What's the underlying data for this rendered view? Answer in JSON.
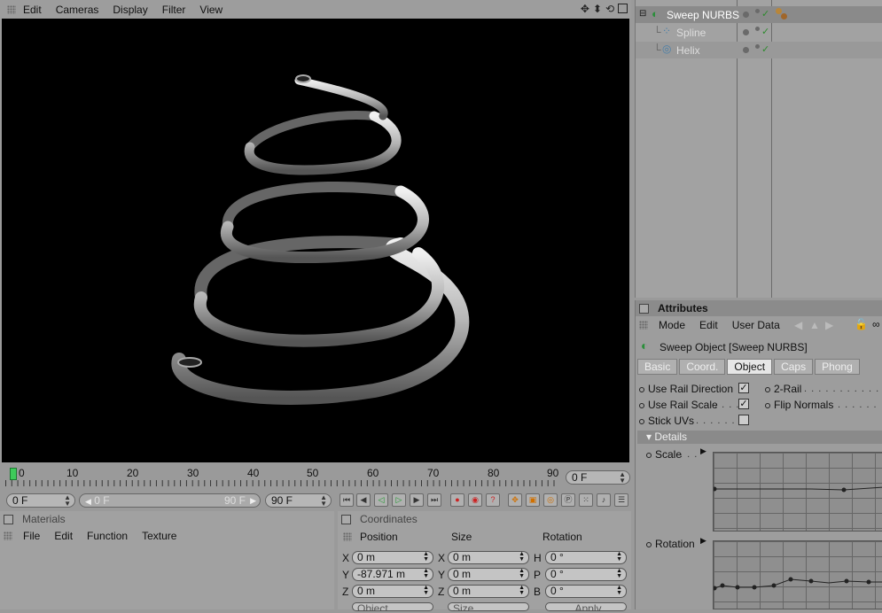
{
  "viewport": {
    "menu": [
      "Edit",
      "Cameras",
      "Display",
      "Filter",
      "View"
    ]
  },
  "object_manager": {
    "objects": [
      {
        "name": "Sweep NURBS",
        "icon": "sweep-nurbs-icon"
      },
      {
        "name": "Spline",
        "icon": "spline-icon"
      },
      {
        "name": "Helix",
        "icon": "helix-icon"
      }
    ]
  },
  "attributes": {
    "title": "Attributes",
    "menu": [
      "Mode",
      "Edit",
      "User Data"
    ],
    "object_title": "Sweep Object [Sweep NURBS]",
    "tabs": [
      "Basic",
      "Coord.",
      "Object",
      "Caps",
      "Phong"
    ],
    "active_tab": "Object",
    "params_left": [
      "Use Rail Direction",
      "Use Rail Scale",
      "Stick UVs"
    ],
    "params_right": [
      "2-Rail",
      "Flip Normals"
    ],
    "checks": [
      "✓",
      "✓",
      ""
    ],
    "details_label": "Details",
    "scale_label": "Scale",
    "scale_dots": ". . .",
    "rotation_label": "Rotation"
  },
  "timeline": {
    "ticks": [
      "0",
      "10",
      "20",
      "30",
      "40",
      "50",
      "60",
      "70",
      "80",
      "90"
    ],
    "current_frame": "0 F",
    "start_field": "0 F",
    "range_start": "0 F",
    "range_end": "90 F",
    "end_field": "90 F"
  },
  "materials": {
    "title": "Materials",
    "menu": [
      "File",
      "Edit",
      "Function",
      "Texture"
    ]
  },
  "coordinates": {
    "title": "Coordinates",
    "headers": [
      "Position",
      "Size",
      "Rotation"
    ],
    "rows": [
      {
        "axis": "X",
        "pos": "0 m",
        "saxis": "X",
        "size": "0 m",
        "raxis": "H",
        "rot": "0 °"
      },
      {
        "axis": "Y",
        "pos": "-87.971 m",
        "saxis": "Y",
        "size": "0 m",
        "raxis": "P",
        "rot": "0 °"
      },
      {
        "axis": "Z",
        "pos": "0 m",
        "saxis": "Z",
        "size": "0 m",
        "raxis": "B",
        "rot": "0 °"
      }
    ],
    "mode_select": "Object",
    "size_select": "Size",
    "apply_label": "Apply"
  }
}
